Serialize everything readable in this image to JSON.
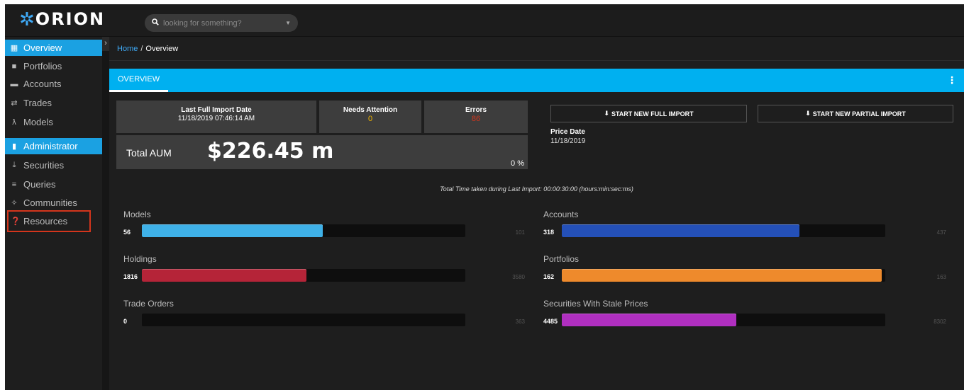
{
  "app": {
    "logo_text": "ORION",
    "logo_mark": "✲"
  },
  "search": {
    "placeholder": "looking for something?"
  },
  "sidebar": {
    "items": [
      {
        "label": "Overview",
        "icon": "grid-icon"
      },
      {
        "label": "Portfolios",
        "icon": "portfolio-icon"
      },
      {
        "label": "Accounts",
        "icon": "briefcase-icon"
      },
      {
        "label": "Trades",
        "icon": "exchange-icon"
      },
      {
        "label": "Models",
        "icon": "model-icon"
      },
      {
        "label": "Administrator",
        "icon": "admin-icon"
      },
      {
        "label": "Securities",
        "icon": "securities-icon"
      },
      {
        "label": "Queries",
        "icon": "list-icon"
      },
      {
        "label": "Communities",
        "icon": "communities-icon"
      },
      {
        "label": "Resources",
        "icon": "question-icon"
      }
    ]
  },
  "breadcrumb": {
    "home": "Home",
    "separator": "/",
    "current": "Overview"
  },
  "panel": {
    "tab": "OVERVIEW"
  },
  "stats": {
    "import_label": "Last Full Import Date",
    "import_value": "11/18/2019 07:46:14 AM",
    "attention_label": "Needs Attention",
    "attention_value": "0",
    "errors_label": "Errors",
    "errors_value": "86",
    "aum_label": "Total AUM",
    "aum_value": "$226.45 m",
    "aum_pct": "0 %"
  },
  "buttons": {
    "full_import": "START NEW FULL IMPORT",
    "partial_import": "START NEW PARTIAL IMPORT"
  },
  "price_date": {
    "label": "Price Date",
    "value": "11/18/2019"
  },
  "time_note": "Total Time taken during Last Import: 00:00:30:00 (hours:min:sec:ms)",
  "metrics": [
    {
      "label": "Models",
      "count": "56",
      "max": "101",
      "fraction": 0.56,
      "color": "#3fb1e8"
    },
    {
      "label": "Accounts",
      "count": "318",
      "max": "437",
      "fraction": 0.735,
      "color": "#2450b8"
    },
    {
      "label": "Holdings",
      "count": "1816",
      "max": "3580",
      "fraction": 0.508,
      "color": "#b52438"
    },
    {
      "label": "Portfolios",
      "count": "162",
      "max": "163",
      "fraction": 0.99,
      "color": "#ee8a2c"
    },
    {
      "label": "Trade Orders",
      "count": "0",
      "max": "363",
      "fraction": 0,
      "color": "#3fb1e8"
    },
    {
      "label": "Securities With Stale Prices",
      "count": "4485",
      "max": "8302",
      "fraction": 0.54,
      "color": "#b02fc0"
    }
  ]
}
